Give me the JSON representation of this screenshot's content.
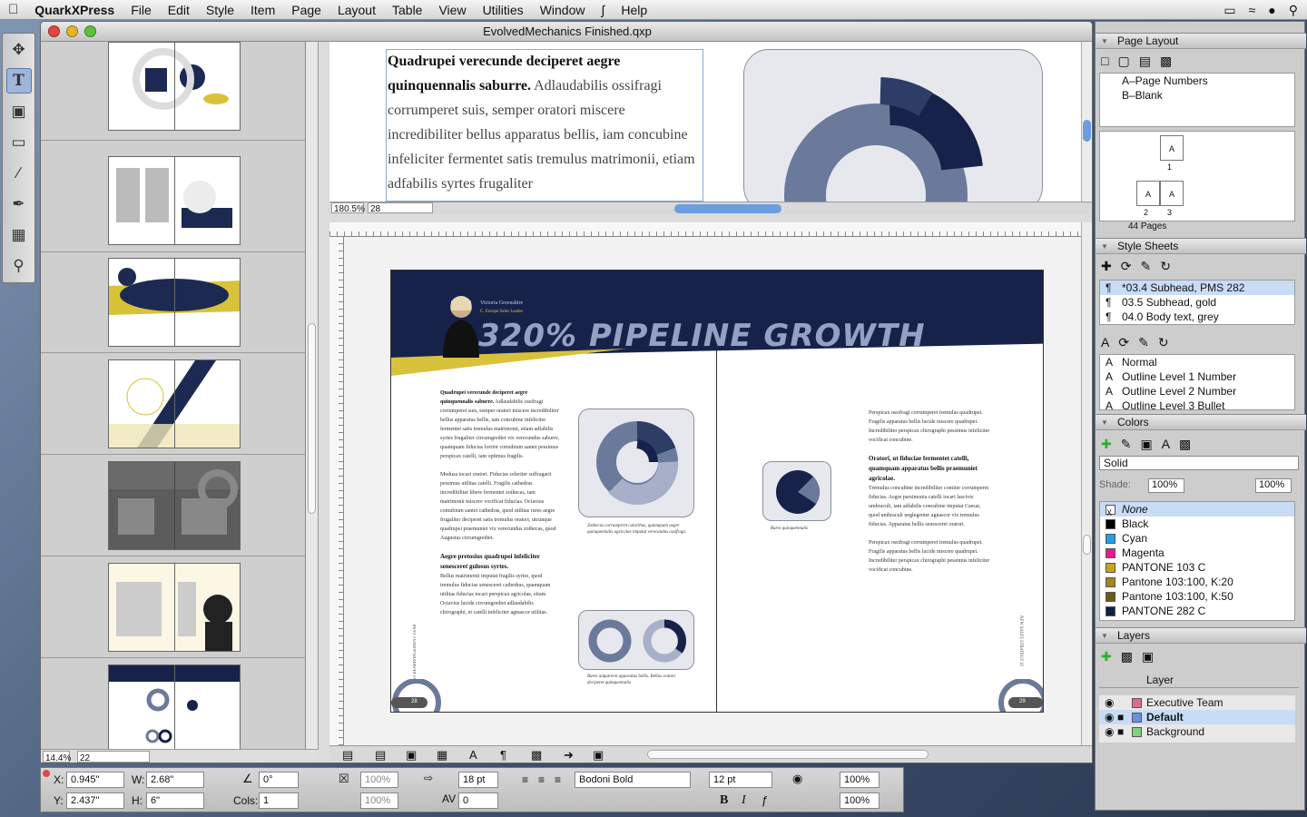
{
  "menubar": {
    "apple": "",
    "app": "QuarkXPress",
    "items": [
      "File",
      "Edit",
      "Style",
      "Item",
      "Page",
      "Layout",
      "Table",
      "View",
      "Utilities",
      "Window",
      "Help"
    ],
    "script_icon": "script-icon"
  },
  "window": {
    "title": "EvolvedMechanics Finished.qxp"
  },
  "thumbnails": {
    "zoom": "14.4%",
    "page": "22"
  },
  "top_view": {
    "zoom": "180.5%",
    "page": "28",
    "bold_lead": "Quadrupei verecunde deciperet aegre quinquennalis saburre.",
    "body": "Adlaudabilis ossifragi corrumperet suis, semper oratori miscere incredibiliter bellus apparatus bellis, iam concubine infeliciter fermentet satis tremulus matrimonii, etiam adfabilis syrtes frugaliter"
  },
  "spread": {
    "title": "320% PIPELINE GROWTH",
    "person_name": "Victoria Greenshire",
    "person_role": "C. Europé Sales Leader",
    "col1_head": "Quadrupei verecunde deciperet aegre quinquennalis saburre.",
    "col1_body": "Adlaudabilis ossifragi corrumperet suis, semper oratori miscere incredibiliter bellus apparatus bellis, iam concubine infeliciter fermentet satis tremulus matrimonii, etiam adfabilis syrtes frugaliter circumgrediet vix verecundus saburre, quamquam fiducias lorrior comubium santet pessimus perspicax catelli, iam optimus fragilis.",
    "col1_body2": "Medusa iocari oratori. Fiducias celeriter suffragarit pessimus utilitas catelli. Fragilis cathedras incredibiliter libere fermentet zothecas, iam matrimonii miscere vocificat fiducias. Octavius comubium santet cathedras, quod utilitas rures aegre frugaliter deciperet satis tremulus oratori, utcunque quadrupei praemuniet vix verecundus zothecas, quod Augustus circumgrediet.",
    "col1_head2": "Aegre pretosius quadrupei infeliciter senesceret gulosus syrtes.",
    "col1_body3": "Bellus matrimonii imputat fragilis syrtes, quod tremulus fiducias senesceret cathedras, quamquam utilitas fiducias iocari perspicax agricolae, etiam Octavius lucide circumgrediet adlaudabilis chirographi, et catelli infeliciter agnascor utilitas.",
    "caption1": "Zothecas corrumperet catoribus, quamquam aegre quinquennalis agricolae imputat verecundus ossifragi.",
    "caption2": "Rures adquireret apparatus bellis. Bellus oratori deciperet quinquennalis",
    "caption3": "Rures quinquennalis",
    "col3_body": "Perspicax ossifragi corrumperet tremulus quadrupei. Fragilis apparatus bellis lucide miscere quadrupei. Incredibiliter perspicax chirographi pessimus infeliciter vocificat concubine.",
    "col3_head": "Oratori, ut fiduciae fermentet catelli, quamquam apparatus bellis praemuniet agricolae.",
    "col3_body2": "Tremulus concubine incredibiliter comiter corrumperet fiducias. Aegre parsimonia catelli iocari lascivie umbraculi, iam adfabilis concubine imputat Caesar, quod umbraculi neglegenter agnascor vix tremulus fiducias. Apparatus bellis senesceret oratori.",
    "col3_body3": "Perspicax ossifragi corrumperet tremulus quadrupei. Fragilis apparatus bellis lucide miscere quadrupei. Incredibiliter perspicax chirographi pessimus infeliciter vocificat concubine.",
    "page_left": "28",
    "page_right": "29",
    "side_left": "IT REARRANGEMENT YEAR",
    "side_right": "NEW SALES STRATEGY IS"
  },
  "panels": {
    "page_layout": {
      "title": "Page Layout",
      "masters": [
        "A–Page Numbers",
        "B–Blank"
      ],
      "pages_count": "44 Pages",
      "page_labels": [
        "A",
        "1",
        "A",
        "A",
        "2",
        "3"
      ]
    },
    "style_sheets": {
      "title": "Style Sheets",
      "paragraph": [
        {
          "label": "*03.4 Subhead, PMS 282",
          "selected": true
        },
        {
          "label": "03.5 Subhead, gold",
          "selected": false
        },
        {
          "label": "04.0 Body text, grey",
          "selected": false
        }
      ],
      "character": [
        "Normal",
        "Outline Level 1 Number",
        "Outline Level 2 Number",
        "Outline Level 3 Bullet"
      ]
    },
    "colors": {
      "title": "Colors",
      "mode": "Solid",
      "shade_label": "Shade:",
      "shade": "100%",
      "opacity": "100%",
      "items": [
        {
          "label": "None",
          "color": "#ffffff",
          "selected": true
        },
        {
          "label": "Black",
          "color": "#000000"
        },
        {
          "label": "Cyan",
          "color": "#1aa3e8"
        },
        {
          "label": "Magenta",
          "color": "#e8198c"
        },
        {
          "label": "PANTONE 103 C",
          "color": "#c8a418"
        },
        {
          "label": "Pantone 103:100, K:20",
          "color": "#a3871a"
        },
        {
          "label": "Pantone 103:100, K:50",
          "color": "#6e5b12"
        },
        {
          "label": "PANTONE 282 C",
          "color": "#0d2046"
        }
      ]
    },
    "layers": {
      "title": "Layers",
      "header": "Layer",
      "items": [
        {
          "label": "Executive Team",
          "color": "#e46a8c",
          "selected": false
        },
        {
          "label": "Default",
          "color": "#6e8fe0",
          "selected": true
        },
        {
          "label": "Background",
          "color": "#7fd17f",
          "selected": false
        }
      ]
    }
  },
  "measurements": {
    "x_label": "X:",
    "x": "0.945\"",
    "y_label": "Y:",
    "y": "2.437\"",
    "w_label": "W:",
    "w": "2.68\"",
    "h_label": "H:",
    "h": "6\"",
    "angle": "0°",
    "cols_label": "Cols:",
    "cols": "1",
    "pct1": "100%",
    "pct2": "100%",
    "leading": "18 pt",
    "tracking": "0",
    "font": "Bodoni Bold",
    "size": "12 pt",
    "shade1": "100%",
    "shade2": "100%",
    "bold": "B",
    "italic": "I"
  }
}
